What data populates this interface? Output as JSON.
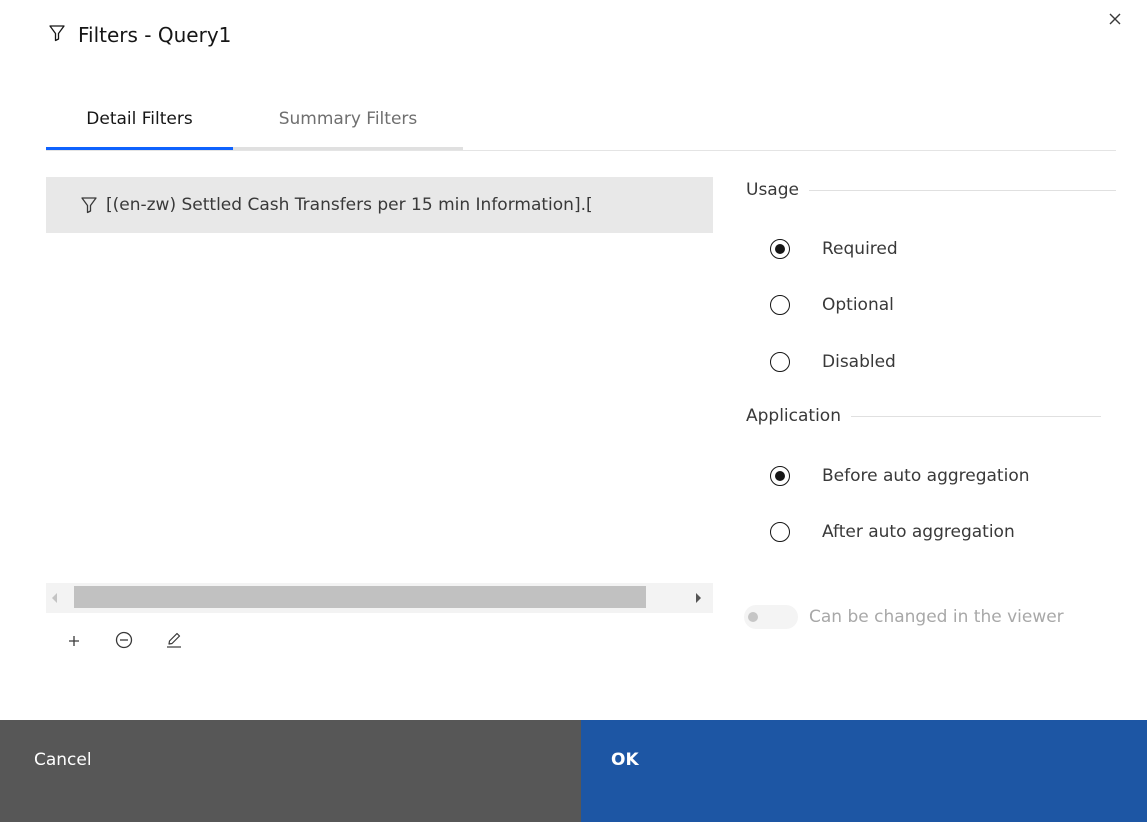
{
  "dialog": {
    "title": "Filters - Query1",
    "close_icon": "close-icon",
    "title_icon": "filter-icon"
  },
  "tabs": [
    {
      "label": "Detail Filters",
      "active": true
    },
    {
      "label": "Summary Filters",
      "active": false
    }
  ],
  "filter_list": {
    "items": [
      {
        "text": "[(en-zw) Settled Cash Transfers per 15 min Information].[",
        "icon": "filter-icon"
      }
    ]
  },
  "list_actions": [
    {
      "name": "add-icon",
      "glyph": "+"
    },
    {
      "name": "remove-icon",
      "glyph": "⊖"
    },
    {
      "name": "edit-icon",
      "glyph": "pencil"
    }
  ],
  "usage": {
    "label": "Usage",
    "options": [
      {
        "label": "Required",
        "selected": true
      },
      {
        "label": "Optional",
        "selected": false
      },
      {
        "label": "Disabled",
        "selected": false
      }
    ]
  },
  "application": {
    "label": "Application",
    "options": [
      {
        "label": "Before auto aggregation",
        "selected": true
      },
      {
        "label": "After auto aggregation",
        "selected": false
      }
    ]
  },
  "viewer_toggle": {
    "label": "Can be changed in the viewer",
    "enabled": false,
    "on": false
  },
  "footer": {
    "cancel_label": "Cancel",
    "ok_label": "OK"
  },
  "colors": {
    "accent": "#0f62fe",
    "ok_button": "#1d56a4",
    "cancel_button": "#575757",
    "row_selected": "#e8e8e8"
  }
}
